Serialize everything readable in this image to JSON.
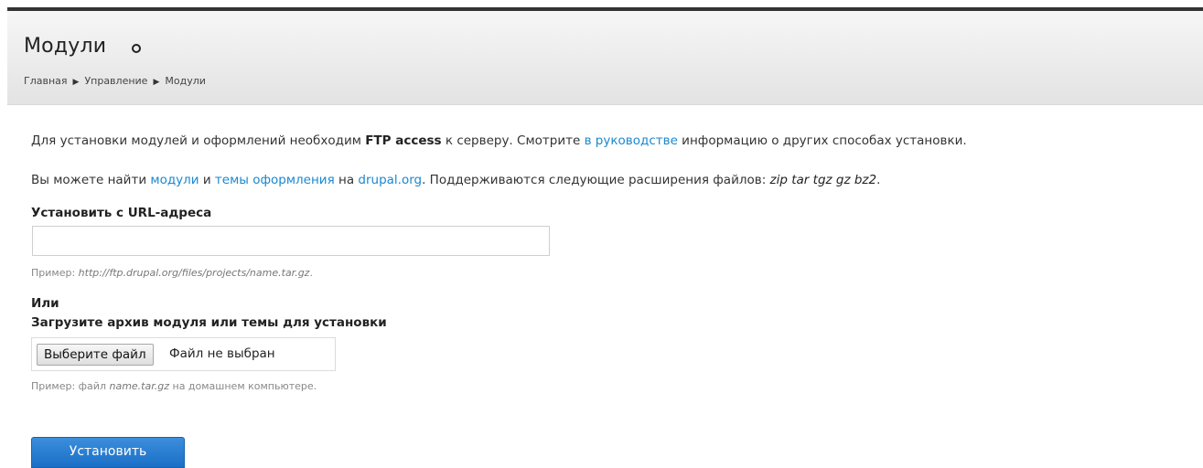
{
  "header": {
    "title": "Модули",
    "breadcrumb": [
      "Главная",
      "Управление",
      "Модули"
    ],
    "breadcrumb_separator": "▶"
  },
  "intro": {
    "p1_before": "Для установки модулей и оформлений необходим ",
    "p1_bold": "FTP access",
    "p1_mid": " к серверу. Смотрите ",
    "p1_link": "в руководстве",
    "p1_after": " информацию о других способах установки.",
    "p2_before": "Вы можете найти ",
    "p2_link1": "модули",
    "p2_and": " и ",
    "p2_link2": "темы оформления",
    "p2_on": " на ",
    "p2_link3": "drupal.org",
    "p2_after": ". Поддерживаются следующие расширения файлов: ",
    "p2_ext": "zip tar tgz gz bz2",
    "p2_end": "."
  },
  "url_install": {
    "label": "Установить с URL-адреса",
    "value": "",
    "desc_prefix": "Пример: ",
    "desc_example": "http://ftp.drupal.org/files/projects/name.tar.gz",
    "desc_suffix": "."
  },
  "or_label": "Или",
  "upload": {
    "label": "Загрузите архив модуля или темы для установки",
    "button_label": "Выберите файл",
    "status": "Файл не выбран",
    "desc_prefix": "Пример: файл ",
    "desc_example": "name.tar.gz",
    "desc_suffix": " на домашнем компьютере."
  },
  "submit": {
    "label": "Установить"
  },
  "colors": {
    "link": "#1a88d0",
    "button": "#2a7fd2",
    "header_bg": "#ececec"
  }
}
